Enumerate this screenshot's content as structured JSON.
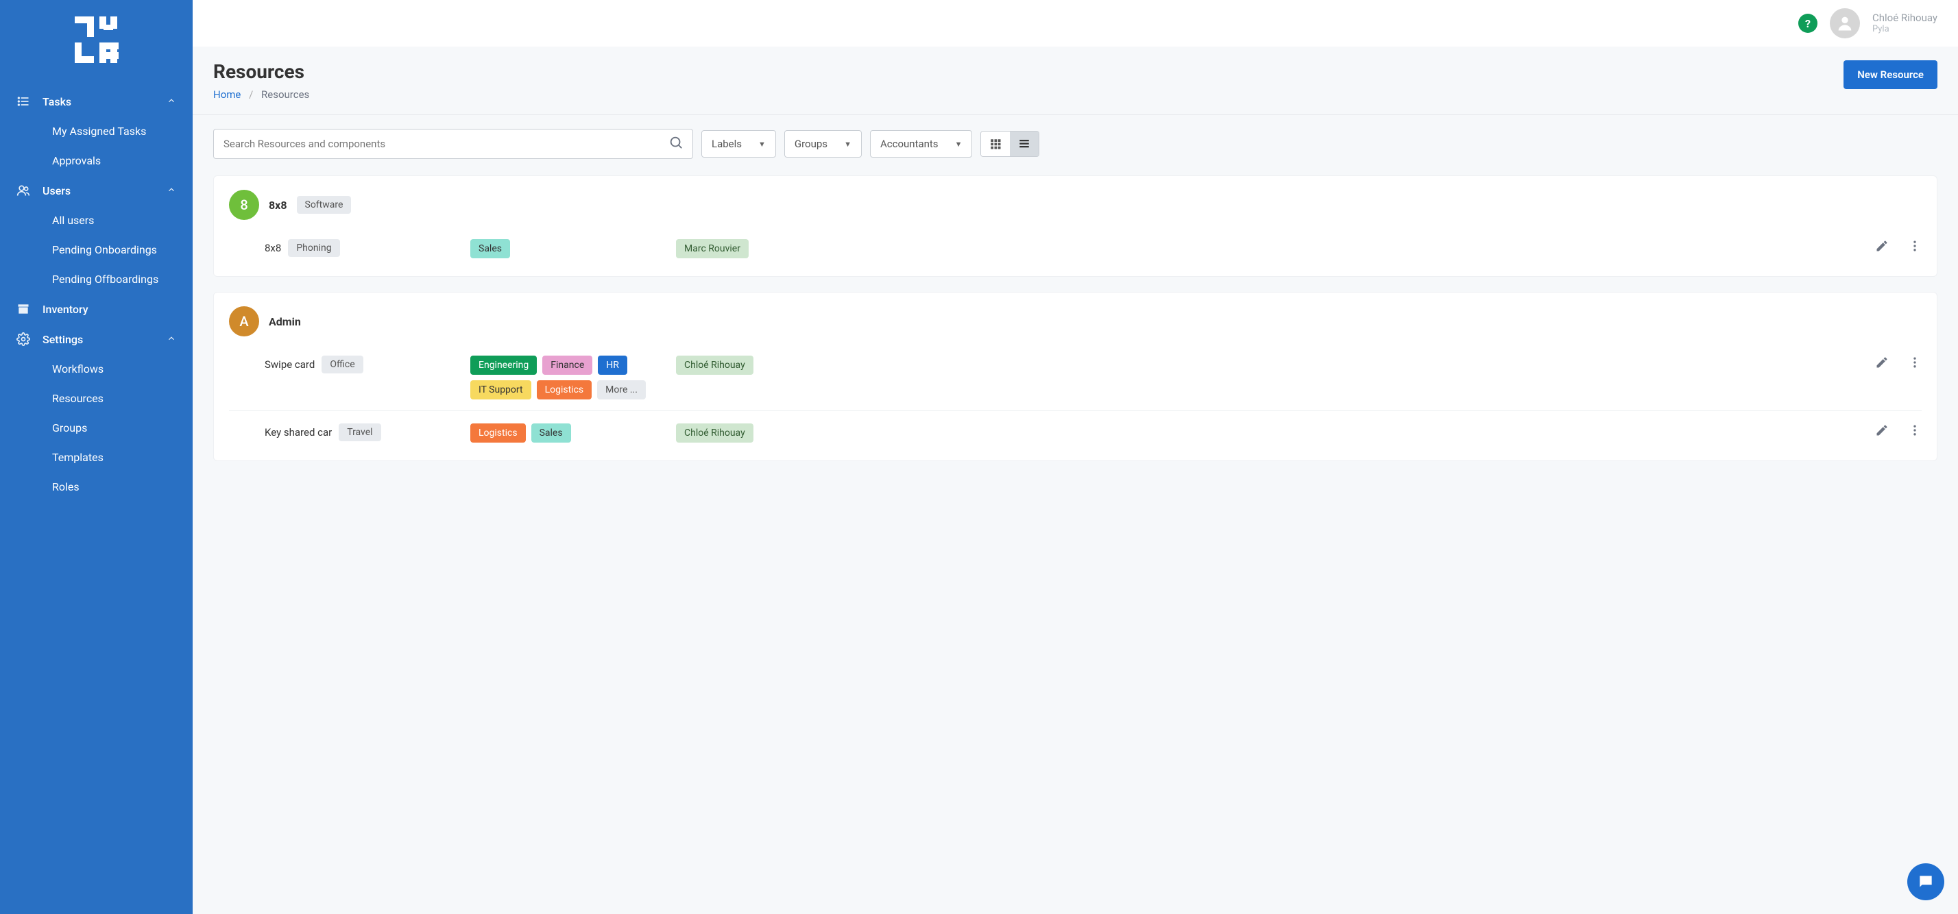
{
  "brand": "PYLA",
  "user": {
    "name": "Chloé Rihouay",
    "org": "Pyla"
  },
  "page": {
    "title": "Resources",
    "breadcrumb_home": "Home",
    "breadcrumb_current": "Resources",
    "new_btn": "New Resource"
  },
  "search": {
    "placeholder": "Search Resources and components"
  },
  "filters": {
    "labels": "Labels",
    "groups": "Groups",
    "accountants": "Accountants"
  },
  "sidebar": {
    "tasks": {
      "label": "Tasks",
      "items": [
        {
          "label": "My Assigned Tasks"
        },
        {
          "label": "Approvals"
        }
      ]
    },
    "users": {
      "label": "Users",
      "items": [
        {
          "label": "All users"
        },
        {
          "label": "Pending Onboardings"
        },
        {
          "label": "Pending Offboardings"
        }
      ]
    },
    "inventory": {
      "label": "Inventory"
    },
    "settings": {
      "label": "Settings",
      "items": [
        {
          "label": "Workflows"
        },
        {
          "label": "Resources"
        },
        {
          "label": "Groups"
        },
        {
          "label": "Templates"
        },
        {
          "label": "Roles"
        }
      ]
    }
  },
  "resources": [
    {
      "avatar_letter": "8",
      "avatar_color": "#6fbf3b",
      "title": "8x8",
      "type": "Software",
      "rows": [
        {
          "name": "8x8",
          "type": "Phoning",
          "tags": [
            {
              "label": "Sales",
              "cls": "tag-sales"
            }
          ],
          "owner": "Marc Rouvier"
        }
      ]
    },
    {
      "avatar_letter": "A",
      "avatar_color": "#d08a2b",
      "title": "Admin",
      "type": "",
      "rows": [
        {
          "name": "Swipe card",
          "type": "Office",
          "tags": [
            {
              "label": "Engineering",
              "cls": "tag-eng"
            },
            {
              "label": "Finance",
              "cls": "tag-fin"
            },
            {
              "label": "HR",
              "cls": "tag-hr"
            },
            {
              "label": "IT Support",
              "cls": "tag-it"
            },
            {
              "label": "Logistics",
              "cls": "tag-log"
            },
            {
              "label": "More ...",
              "cls": "tag-more"
            }
          ],
          "owner": "Chloé Rihouay"
        },
        {
          "name": "Key shared car",
          "type": "Travel",
          "tags": [
            {
              "label": "Logistics",
              "cls": "tag-log"
            },
            {
              "label": "Sales",
              "cls": "tag-sales"
            }
          ],
          "owner": "Chloé Rihouay"
        }
      ]
    }
  ]
}
